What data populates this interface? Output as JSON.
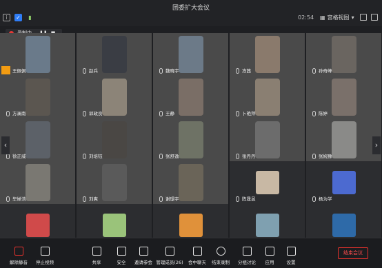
{
  "window": {
    "title": "团委扩大会议",
    "clock": "02:54",
    "view_mode": "宫格视图"
  },
  "recording": {
    "label": "录制中"
  },
  "participants": [
    {
      "name": "王佩佩",
      "kind": "video",
      "color": "#6a7a8a"
    },
    {
      "name": "赵兵",
      "kind": "video",
      "color": "#3a3d44"
    },
    {
      "name": "魏晓宇",
      "kind": "video",
      "color": "#6c7a88"
    },
    {
      "name": "冻茜",
      "kind": "video",
      "color": "#8a7a6c"
    },
    {
      "name": "孙奇峰",
      "kind": "video",
      "color": "#6a6560"
    },
    {
      "name": "方澜南",
      "kind": "video",
      "color": "#5b5650"
    },
    {
      "name": "郭政良",
      "kind": "video",
      "color": "#8c8478"
    },
    {
      "name": "王静",
      "kind": "video",
      "color": "#7a6e66"
    },
    {
      "name": "卜艳萍",
      "kind": "video",
      "color": "#8a7f72"
    },
    {
      "name": "陈婷",
      "kind": "video",
      "color": "#7a706a"
    },
    {
      "name": "徐正威",
      "kind": "video",
      "color": "#5c6168"
    },
    {
      "name": "刘培钰",
      "kind": "video",
      "color": "#4a4744"
    },
    {
      "name": "张舒逸",
      "kind": "video",
      "color": "#6e7265"
    },
    {
      "name": "张丹丹",
      "kind": "video",
      "color": "#6c6c6c"
    },
    {
      "name": "张婉豫",
      "kind": "video",
      "color": "#8a8a88"
    },
    {
      "name": "毕婵浩",
      "kind": "video",
      "color": "#7a7872"
    },
    {
      "name": "刘爽",
      "kind": "video",
      "color": "#5a5a5a"
    },
    {
      "name": "谢璟宇",
      "kind": "video",
      "color": "#6a6458"
    },
    {
      "name": "陈晟昱",
      "kind": "avatar",
      "color": "#c8b8a4"
    },
    {
      "name": "杨为学",
      "kind": "avatar",
      "color": "#4c6ad0"
    },
    {
      "name": "",
      "kind": "avatar",
      "color": "#d04a4a"
    },
    {
      "name": "",
      "kind": "avatar",
      "color": "#9ac37a"
    },
    {
      "name": "",
      "kind": "avatar",
      "color": "#e0913a"
    },
    {
      "name": "",
      "kind": "avatar",
      "color": "#7fa0b0"
    },
    {
      "name": "",
      "kind": "avatar",
      "color": "#2e6aa8"
    }
  ],
  "toolbar": {
    "unmute": "解除静音",
    "stop_video": "停止视频",
    "share": "共享",
    "security": "安全",
    "invite": "邀请参会",
    "manage": "管理成员(26)",
    "chat": "会中聊天",
    "end_record": "结束录制",
    "breakout": "分组讨论",
    "apps": "应用",
    "settings": "设置",
    "end_meeting": "结束会议"
  },
  "colors": {
    "accent_red": "#e5322d",
    "bg": "#1e1f22"
  }
}
